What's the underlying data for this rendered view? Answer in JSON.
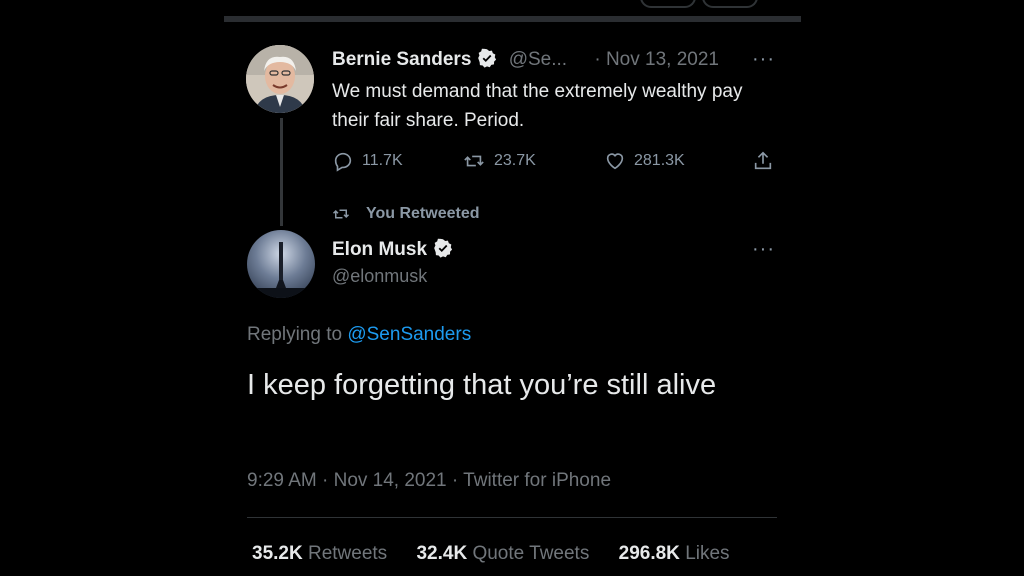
{
  "original_tweet": {
    "author_name": "Bernie Sanders",
    "handle": "@Se...",
    "date": "· Nov 13, 2021",
    "text": "We must demand that the extremely wealthy pay their fair share. Period.",
    "replies": "11.7K",
    "retweets": "23.7K",
    "likes": "281.3K",
    "more": "···"
  },
  "retweet_notice": "You Retweeted",
  "reply_tweet": {
    "author_name": "Elon Musk",
    "handle": "@elonmusk",
    "more": "···",
    "replying_prefix": "Replying to",
    "replying_to": "@SenSanders",
    "text": "I keep forgetting that you’re still alive",
    "meta": "9:29 AM · Nov 14, 2021 · Twitter for iPhone",
    "stats": {
      "retweets_count": "35.2K",
      "retweets_label": "Retweets",
      "quotes_count": "32.4K",
      "quotes_label": "Quote Tweets",
      "likes_count": "296.8K",
      "likes_label": "Likes"
    }
  },
  "colors": {
    "background": "#000000",
    "text": "#e7e9ea",
    "muted": "#71767b",
    "link": "#1d9bf0",
    "verified": "#e7e9ea"
  }
}
